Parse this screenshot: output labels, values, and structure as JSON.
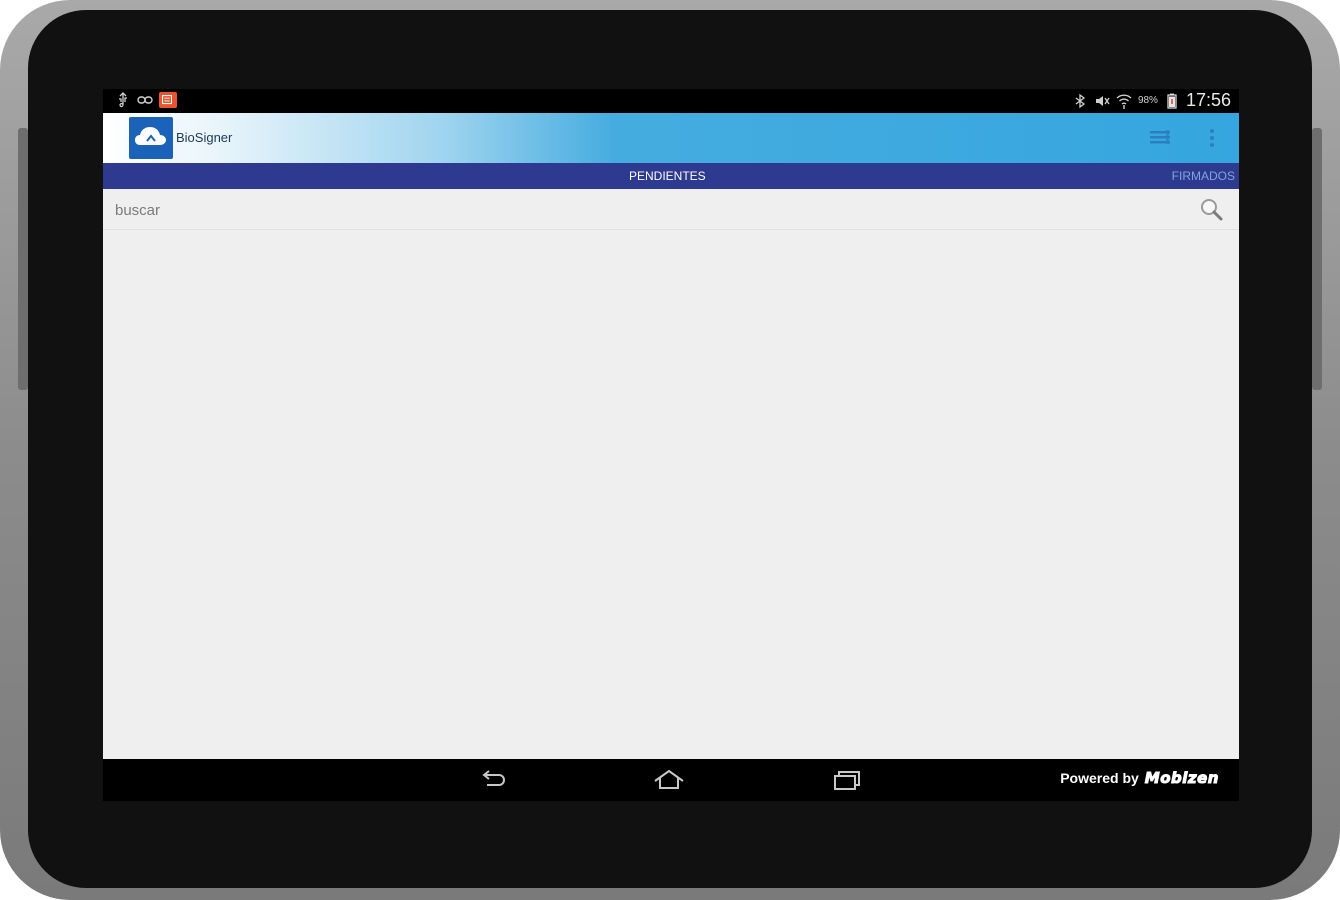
{
  "status_bar": {
    "left_icons": [
      "usb-icon",
      "link-icon",
      "notification-badge-icon"
    ],
    "right_icons": [
      "bluetooth-icon",
      "mute-icon",
      "wifi-icon"
    ],
    "battery_percent": "98%",
    "time": "17:56"
  },
  "action_bar": {
    "app_title": "BioSigner",
    "logo_icon": "cloud-logo-icon",
    "actions": [
      "list-view-icon",
      "overflow-menu-icon"
    ],
    "colors": {
      "gradient_start": "#ffffff",
      "gradient_end": "#35a6df"
    }
  },
  "tabs": {
    "active_label": "PENDIENTES",
    "inactive_label": "FIRMADOS",
    "bar_color": "#2d3a8f"
  },
  "search": {
    "placeholder": "buscar",
    "value": "",
    "icon": "search-icon"
  },
  "nav_bar": {
    "buttons": [
      "back-icon",
      "home-icon",
      "recents-icon"
    ],
    "powered_label": "Powered by",
    "brand": "Mobizen"
  }
}
